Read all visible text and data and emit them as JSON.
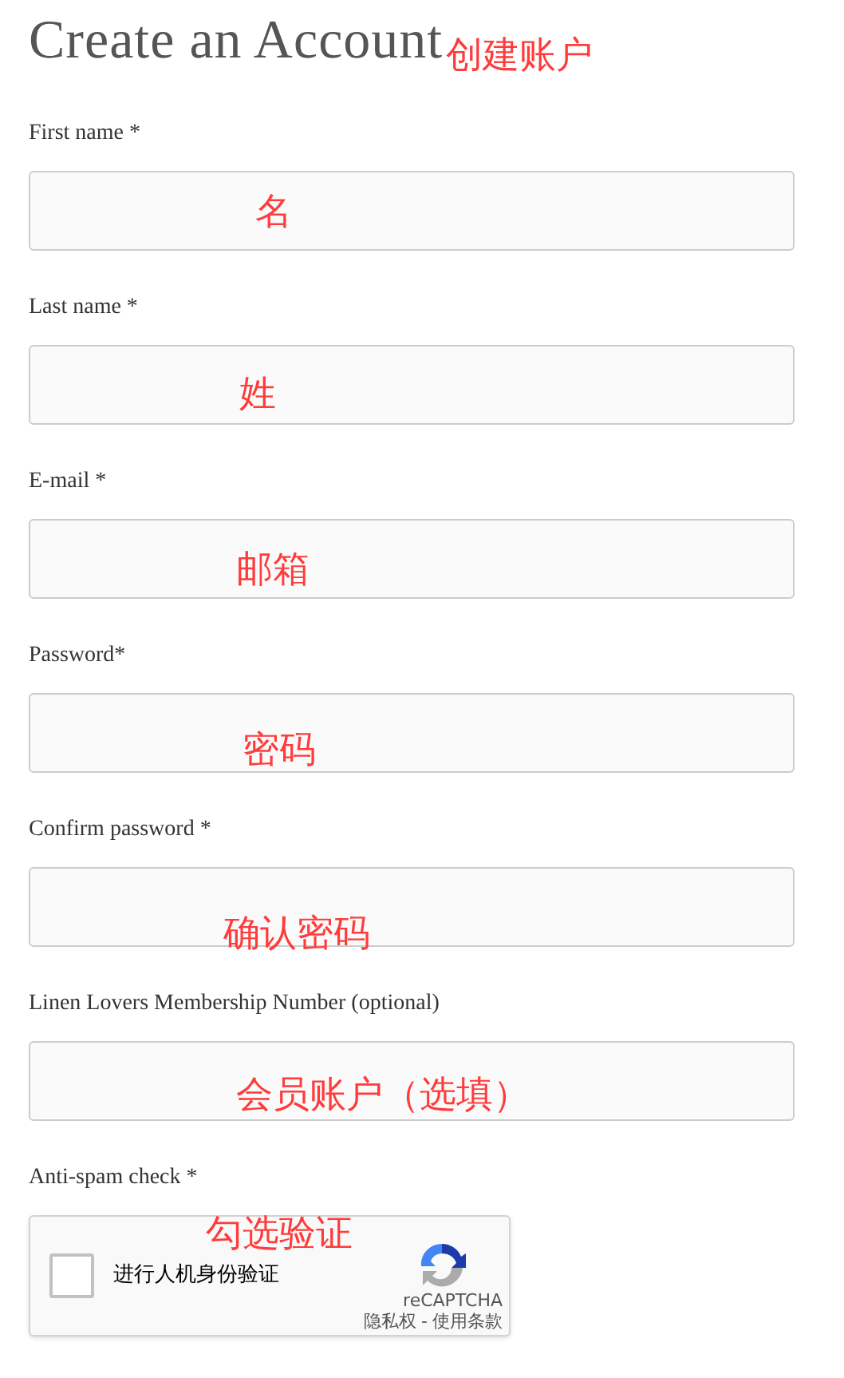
{
  "title": "Create an Account",
  "title_note": "创建账户",
  "fields": [
    {
      "label": "First name *",
      "note": "名"
    },
    {
      "label": "Last name *",
      "note": "姓"
    },
    {
      "label": "E-mail *",
      "note": "邮箱"
    },
    {
      "label": "Password*",
      "note": "密码"
    },
    {
      "label": "Confirm password *",
      "note": "确认密码"
    },
    {
      "label": "Linen Lovers Membership Number (optional)",
      "note": "会员账户（选填）"
    }
  ],
  "captcha": {
    "label": "Anti-spam check *",
    "note": "勾选验证",
    "checked": false,
    "prompt": "进行人机身份验证",
    "brand": "reCAPTCHA",
    "privacy": "隐私权",
    "separator": "-",
    "terms": "使用条款"
  }
}
